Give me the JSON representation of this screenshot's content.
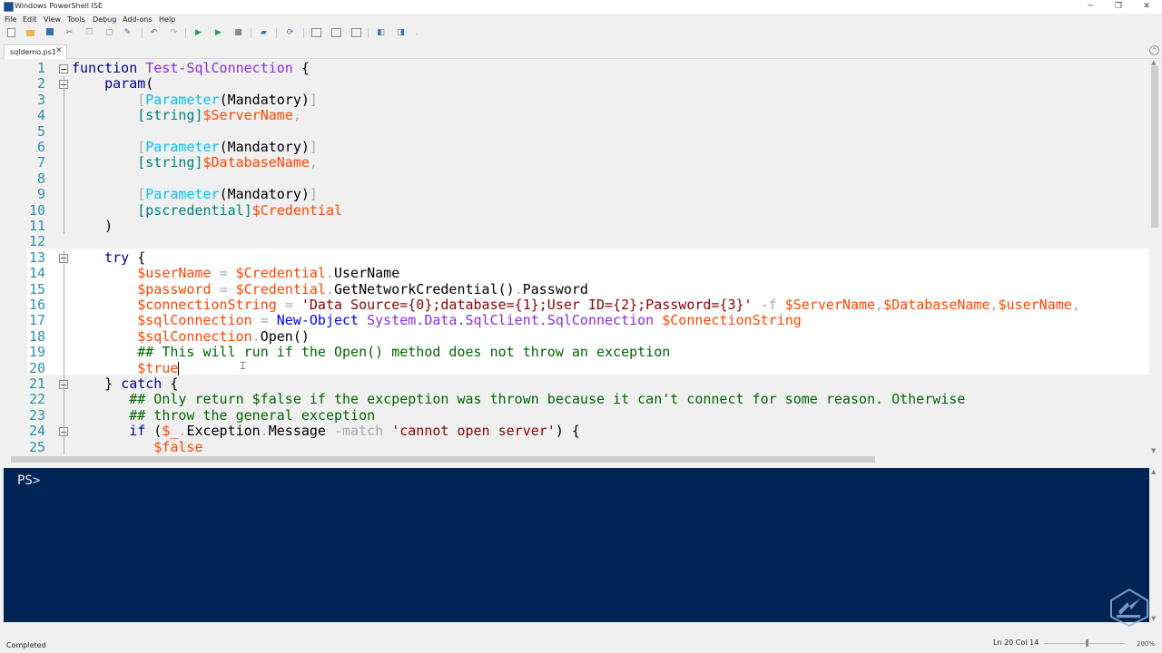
{
  "window": {
    "title": "Windows PowerShell ISE",
    "minimize": "─",
    "restore": "❐",
    "close": "✕"
  },
  "menu": [
    "File",
    "Edit",
    "View",
    "Tools",
    "Debug",
    "Add-ons",
    "Help"
  ],
  "tab": {
    "label": "sqldemo.ps1",
    "close": "✕"
  },
  "editor": {
    "lines": [
      {
        "n": "1",
        "fold": true,
        "html": "<span class=\"kw\">function</span> <span class=\"fn\">Test-SqlConnection</span> {"
      },
      {
        "n": "2",
        "fold": true,
        "html": "    <span class=\"kw\">param</span>("
      },
      {
        "n": "3",
        "fold": false,
        "html": "        <span class=\"op\">[</span><span class=\"at\">Parameter</span>(Mandatory)<span class=\"op\">]</span>"
      },
      {
        "n": "4",
        "fold": false,
        "html": "        <span class=\"ty\">[string]</span><span class=\"vr\">$ServerName</span><span class=\"op\">,</span>"
      },
      {
        "n": "5",
        "fold": false,
        "html": ""
      },
      {
        "n": "6",
        "fold": false,
        "html": "        <span class=\"op\">[</span><span class=\"at\">Parameter</span>(Mandatory)<span class=\"op\">]</span>"
      },
      {
        "n": "7",
        "fold": false,
        "html": "        <span class=\"ty\">[string]</span><span class=\"vr\">$DatabaseName</span><span class=\"op\">,</span>"
      },
      {
        "n": "8",
        "fold": false,
        "html": ""
      },
      {
        "n": "9",
        "fold": false,
        "html": "        <span class=\"op\">[</span><span class=\"at\">Parameter</span>(Mandatory)<span class=\"op\">]</span>"
      },
      {
        "n": "10",
        "fold": false,
        "html": "        <span class=\"ty\">[pscredential]</span><span class=\"vr\">$Credential</span>"
      },
      {
        "n": "11",
        "fold": false,
        "html": "    )"
      },
      {
        "n": "12",
        "fold": false,
        "html": ""
      },
      {
        "n": "13",
        "fold": true,
        "html": "    <span class=\"kw\">try</span> {"
      },
      {
        "n": "14",
        "fold": false,
        "html": "        <span class=\"vr\">$userName</span> <span class=\"op\">=</span> <span class=\"vr\">$Credential</span><span class=\"op\">.</span>UserName"
      },
      {
        "n": "15",
        "fold": false,
        "html": "        <span class=\"vr\">$password</span> <span class=\"op\">=</span> <span class=\"vr\">$Credential</span><span class=\"op\">.</span>GetNetworkCredential()<span class=\"op\">.</span>Password"
      },
      {
        "n": "16",
        "fold": false,
        "html": "        <span class=\"vr\">$connectionString</span> <span class=\"op\">=</span> <span class=\"st\">'Data Source={0};database={1};User ID={2};Password={3}'</span> <span class=\"op\">-f</span> <span class=\"vr\">$ServerName</span><span class=\"op\">,</span><span class=\"vr\">$DatabaseName</span><span class=\"op\">,</span><span class=\"vr\">$userName</span><span class=\"op\">,</span>"
      },
      {
        "n": "17",
        "fold": false,
        "html": "        <span class=\"vr\">$sqlConnection</span> <span class=\"op\">=</span> <span class=\"cmd\">New-Object</span> <span class=\"fn\">System.Data.SqlClient.SqlConnection</span> <span class=\"vr\">$ConnectionString</span>"
      },
      {
        "n": "18",
        "fold": false,
        "html": "        <span class=\"vr\">$sqlConnection</span><span class=\"op\">.</span>Open()"
      },
      {
        "n": "19",
        "fold": false,
        "html": "        <span class=\"cm\">## This will run if the Open() method does not throw an exception</span>"
      },
      {
        "n": "20",
        "fold": false,
        "html": "        <span class=\"vr\">$true</span><span class=\"cursor\"></span>"
      },
      {
        "n": "21",
        "fold": true,
        "html": "    } <span class=\"kw\">catch</span> {"
      },
      {
        "n": "22",
        "fold": false,
        "html": "       <span class=\"cm\">## Only return $false if the excpeption was thrown because it can't connect for some reason. Otherwise</span>"
      },
      {
        "n": "23",
        "fold": false,
        "html": "       <span class=\"cm\">## throw the general exception</span>"
      },
      {
        "n": "24",
        "fold": true,
        "html": "       <span class=\"kw\">if</span> (<span class=\"vr\">$_</span><span class=\"op\">.</span>Exception<span class=\"op\">.</span>Message <span class=\"op\">-match</span> <span class=\"st\">'cannot open server'</span>) {"
      },
      {
        "n": "25",
        "fold": false,
        "html": "          <span class=\"vr\">$false</span>"
      }
    ]
  },
  "console": {
    "prompt": "PS>"
  },
  "status": {
    "left": "Completed",
    "position": "Ln 20  Col 14",
    "zoom": "200%"
  }
}
